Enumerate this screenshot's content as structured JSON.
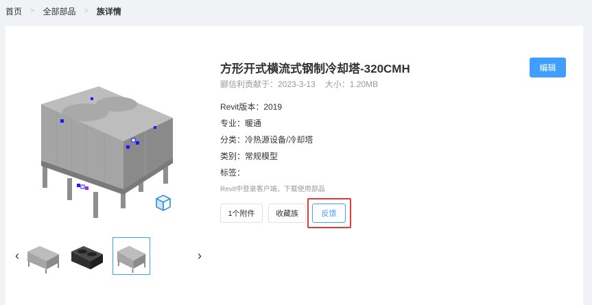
{
  "breadcrumb": {
    "home": "首页",
    "all_parts": "全部部品",
    "current": "族详情",
    "separator": ">"
  },
  "product": {
    "title": "方形开式横流式钢制冷却塔-320CMH",
    "contributor": "郦信利贡献于：2023-3-13",
    "size": "大小：1.20MB",
    "revit_version": "Revit版本：2019",
    "specialty": "专业：暖通",
    "category": "分类：冷热源设备/冷却塔",
    "type": "类别：常规模型",
    "tags": "标签：",
    "hint": "Revit中登录客户端，下载使用部品"
  },
  "buttons": {
    "attachments": "1个附件",
    "favorite": "收藏族",
    "feedback": "反馈",
    "edit": "编辑"
  },
  "carousel": {
    "prev": "‹",
    "next": "›",
    "active_index": 2
  },
  "colors": {
    "primary": "#409eff",
    "highlight": "#e53935"
  },
  "icons": [
    "cube-icon",
    "chevron-left-icon",
    "chevron-right-icon"
  ]
}
